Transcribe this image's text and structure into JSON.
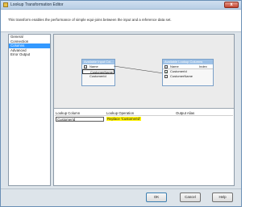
{
  "window": {
    "title": "Lookup Transformation Editor",
    "close_glyph": "x"
  },
  "header": {
    "description": "This transform enables the performance of simple equi-joins between the input and a reference data set."
  },
  "nav": {
    "items": [
      {
        "label": "General"
      },
      {
        "label": "Connection"
      },
      {
        "label": "Columns"
      },
      {
        "label": "Advanced"
      },
      {
        "label": "Error Output"
      }
    ],
    "selected_index": 2
  },
  "input_table": {
    "title": "Available Input Col...",
    "header_col": "Name",
    "rows": [
      "CustomerName",
      "CustomerId"
    ]
  },
  "lookup_table": {
    "title": "Available Lookup Columns",
    "header_cols": [
      "Name",
      "Index"
    ],
    "rows": [
      {
        "name": "CustomerId",
        "checked": true
      },
      {
        "name": "CustomerName",
        "checked": false
      }
    ]
  },
  "mapping_grid": {
    "headers": [
      "Lookup Column",
      "Lookup Operation",
      "Output Alias"
    ],
    "rows": [
      {
        "lookup_column": "CustomerId",
        "operation": "Replace 'CustomerId'",
        "alias": ""
      }
    ]
  },
  "buttons": {
    "ok": "OK",
    "cancel": "Cancel",
    "help": "Help"
  },
  "colors": {
    "selection": "#3399ff",
    "highlight": "#fff200",
    "table_header": "#9ec1e6"
  }
}
